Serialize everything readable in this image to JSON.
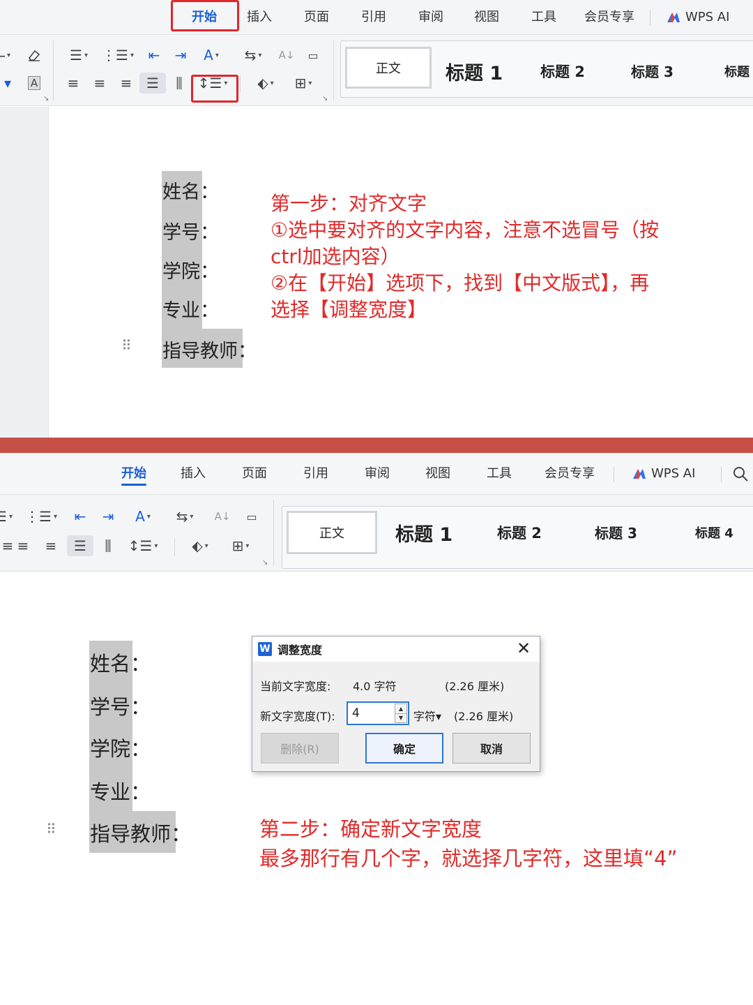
{
  "menu": {
    "tabs": [
      "开始",
      "插入",
      "页面",
      "引用",
      "审阅",
      "视图",
      "工具",
      "会员专享"
    ],
    "active_tab": "开始",
    "wps_ai": "WPS AI"
  },
  "styles": {
    "normal": "正文",
    "h1": "标题 1",
    "h2": "标题 2",
    "h3": "标题 3",
    "h4": "标题 4",
    "h4_cut": "标题"
  },
  "icons": {
    "chinese_layout": "A",
    "clear_format": "A",
    "sort": "A↓"
  },
  "fields": {
    "name": "姓名",
    "student_id": "学号",
    "college": "学院",
    "major": "专业",
    "advisor": "指导教师",
    "colon": "："
  },
  "step1": {
    "line1": "第一步：对齐文字",
    "line2": "①选中要对齐的文字内容，注意不选冒号（按",
    "line3": "ctrl加选内容）",
    "line4": "②在【开始】选项下，找到【中文版式】，再",
    "line5": "选择【调整宽度】"
  },
  "step2": {
    "line1": "第二步：确定新文字宽度",
    "line2": "最多那行有几个字，就选择几字符，这里填“4”"
  },
  "dialog": {
    "title": "调整宽度",
    "logo": "W",
    "close": "✕",
    "current_label": "当前文字宽度:",
    "current_value": "4.0 字符",
    "current_cm": "(2.26 厘米)",
    "new_label": "新文字宽度(T):",
    "new_value": "4",
    "unit": "字符▾",
    "new_cm": "(2.26 厘米)",
    "delete": "删除(R)",
    "ok": "确定",
    "cancel": "取消"
  }
}
